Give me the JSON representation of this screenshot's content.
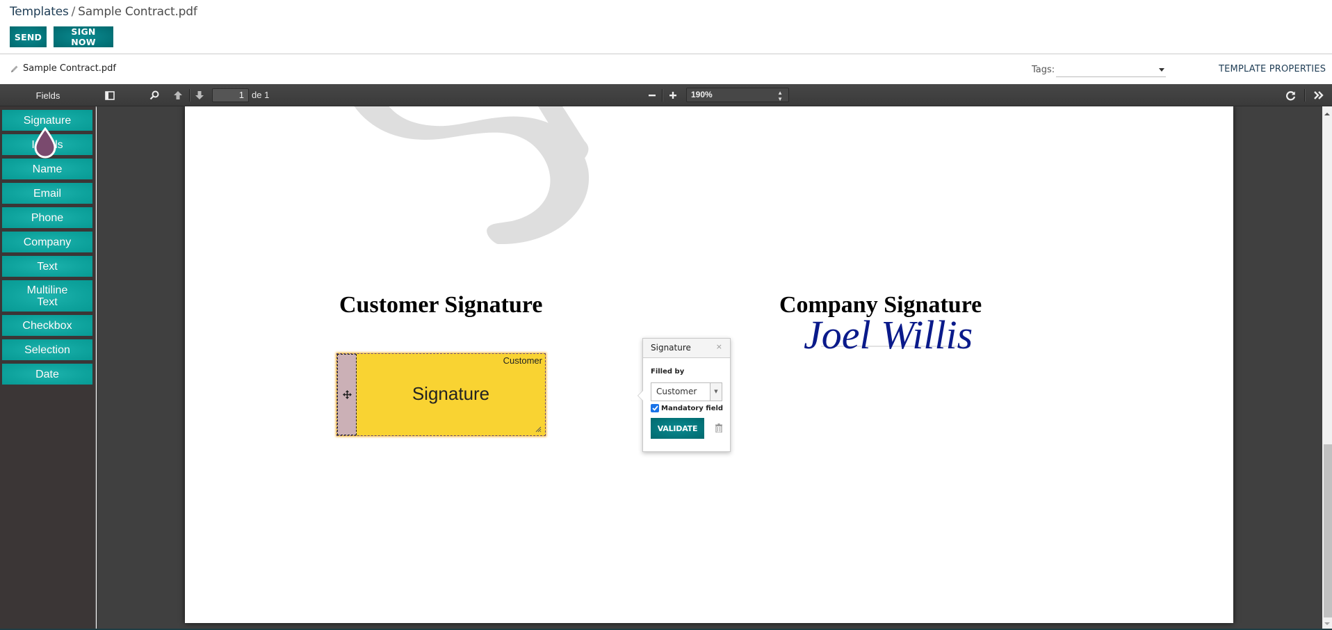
{
  "breadcrumb": {
    "parent": "Templates",
    "separator": "/",
    "current": "Sample Contract.pdf"
  },
  "actions": {
    "send": "SEND",
    "sign_now": "SIGN NOW"
  },
  "subheader": {
    "filename": "Sample Contract.pdf",
    "tags_label": "Tags:",
    "tags_value": "",
    "template_properties": "TEMPLATE PROPERTIES"
  },
  "toolbar": {
    "fields_title": "Fields",
    "page_number": "1",
    "page_of": "de 1",
    "zoom_level": "190%",
    "icons": [
      "sidebar-toggle-icon",
      "search-icon",
      "previous-page-icon",
      "next-page-icon",
      "zoom-out-icon",
      "zoom-in-icon",
      "rotate-icon",
      "tools-icon"
    ]
  },
  "sidebar": {
    "fields": [
      {
        "label": "Signature"
      },
      {
        "label": "Initials"
      },
      {
        "label": "Name"
      },
      {
        "label": "Email"
      },
      {
        "label": "Phone"
      },
      {
        "label": "Company"
      },
      {
        "label": "Text"
      },
      {
        "label": "Multiline Text"
      },
      {
        "label": "Checkbox"
      },
      {
        "label": "Selection"
      },
      {
        "label": "Date"
      }
    ]
  },
  "document": {
    "customer_heading": "Customer Signature",
    "company_heading": "Company Signature",
    "company_signature_name": "Joel Willis",
    "signature_field": {
      "role": "Customer",
      "label": "Signature",
      "field_color": "#f9d332"
    }
  },
  "popover": {
    "title": "Signature",
    "close": "×",
    "filled_by_label": "Filled by",
    "filled_by_value": "Customer",
    "mandatory_label": "Mandatory field",
    "mandatory_checked": true,
    "validate": "VALIDATE"
  },
  "colors": {
    "primary": "#017e84",
    "field_button": "#0ea39d",
    "toolbar": "#404040",
    "signature_ink": "#0a1a8a"
  }
}
